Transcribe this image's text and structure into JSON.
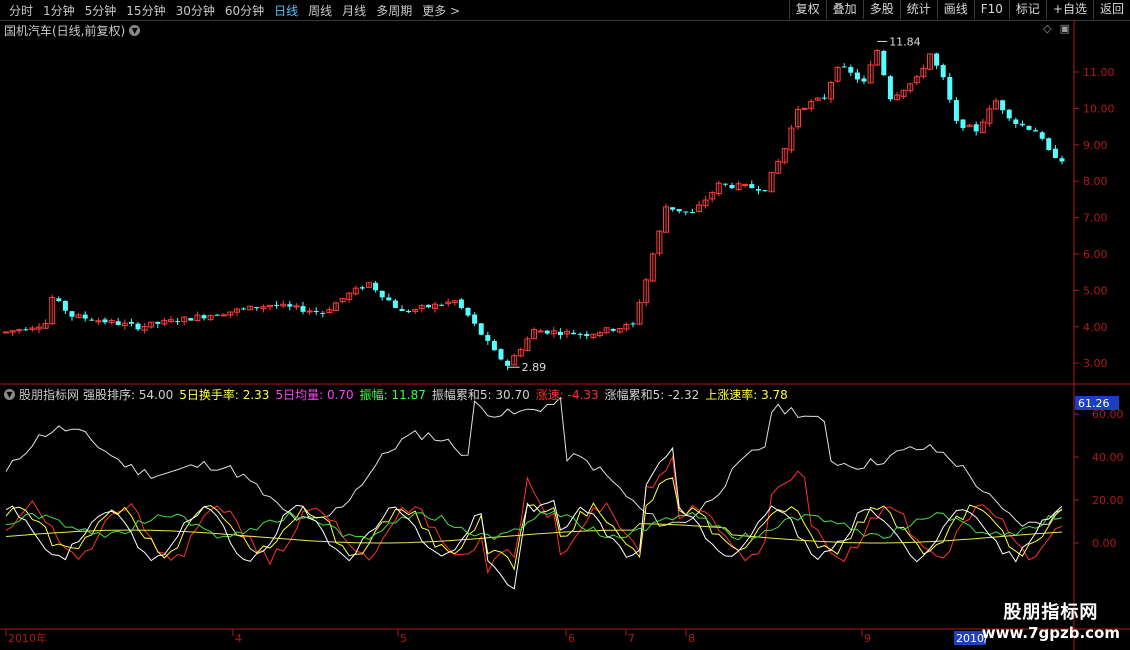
{
  "toolbar": {
    "periods": [
      "分时",
      "1分钟",
      "5分钟",
      "15分钟",
      "30分钟",
      "60分钟",
      "日线",
      "周线",
      "月线",
      "多周期",
      "更多"
    ],
    "active_period": "日线",
    "right_buttons": [
      "复权",
      "叠加",
      "多股",
      "统计",
      "画线",
      "F10",
      "标记",
      "+自选",
      "返回"
    ]
  },
  "stock": {
    "title": "国机汽车(日线,前复权)",
    "high_label": "11.84",
    "low_label": "2.89"
  },
  "price_axis": {
    "ticks": [
      "11.00",
      "10.00",
      "9.00",
      "8.00",
      "7.00",
      "6.00",
      "5.00",
      "4.00",
      "3.00"
    ]
  },
  "indicator": {
    "name": "股朋指标网",
    "items": [
      {
        "label": "强股排序:",
        "value": "54.00",
        "color": "#d0d0d0"
      },
      {
        "label": "5日换手率:",
        "value": "2.33",
        "color": "#ffff40"
      },
      {
        "label": "5日均量:",
        "value": "0.70",
        "color": "#ff40ff"
      },
      {
        "label": "振幅:",
        "value": "11.87",
        "color": "#40ff40"
      },
      {
        "label": "振幅累和5:",
        "value": "30.70",
        "color": "#d0d0d0"
      },
      {
        "label": "涨速:",
        "value": "-4.33",
        "color": "#ff3030"
      },
      {
        "label": "涨幅累和5:",
        "value": "-2.32",
        "color": "#d0d0d0"
      },
      {
        "label": "上涨速率:",
        "value": "3.78",
        "color": "#ffff40"
      }
    ],
    "axis_ticks": [
      "60.00",
      "40.00",
      "20.00",
      "0.00"
    ],
    "current_value": "61.26"
  },
  "date_axis": {
    "labels": [
      "2010年",
      "4",
      "5",
      "6",
      "7",
      "8",
      "9"
    ],
    "highlight": "2010/"
  },
  "watermark": {
    "line1": "股朋指标网",
    "line2": "www.7gpzb.com"
  },
  "colors": {
    "up": "#ff3b3b",
    "down": "#54ffff",
    "frame": "#b01818",
    "accent": "#4fc3ff"
  }
}
